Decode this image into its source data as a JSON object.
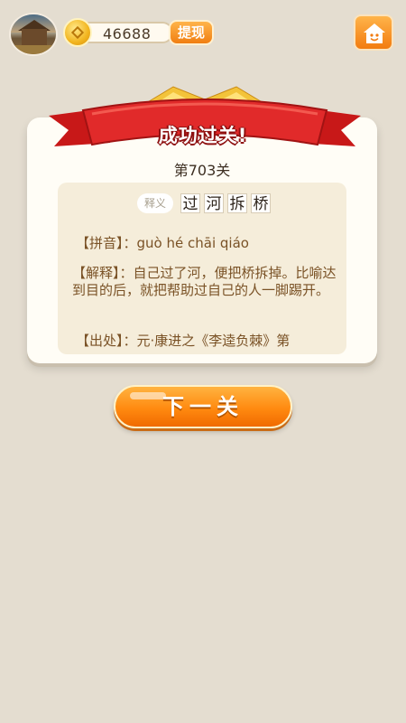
{
  "topbar": {
    "coins": "46688",
    "withdraw_label": "提现"
  },
  "banner": {
    "title": "成功过关!"
  },
  "card": {
    "level_label": "第703关",
    "meaning_tag": "释义",
    "idiom_chars": [
      "过",
      "河",
      "拆",
      "桥"
    ],
    "pinyin_label": "【拼音】：",
    "pinyin_value": "guò hé chāi qiáo",
    "explanation_label": "【解释】：",
    "explanation_value": "自己过了河，便把桥拆掉。比喻达到目的后，就把帮助过自己的人一脚踢开。",
    "source_label": "【出处】：",
    "source_value": "元·康进之《李逵负棘》第"
  },
  "next_button": {
    "label": "下一关"
  },
  "colors": {
    "background": "#e4ddd0",
    "accent_orange": "#f58a15",
    "ribbon_red": "#d42222",
    "text_brown": "#7a5226"
  },
  "icons": {
    "coin": "coin-icon",
    "home": "home-icon",
    "avatar": "avatar-image"
  }
}
